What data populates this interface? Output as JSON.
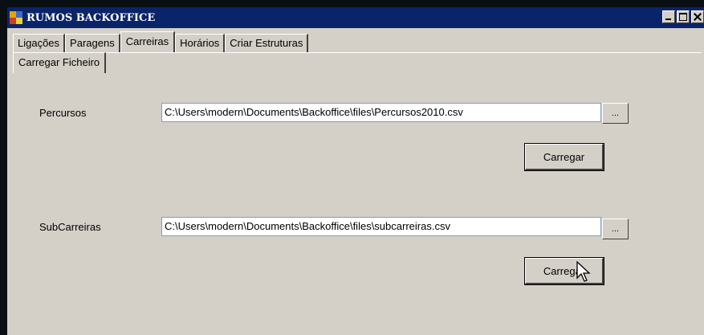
{
  "window": {
    "title": "RUMOS BACKOFFICE"
  },
  "tabs": [
    {
      "label": "Ligações"
    },
    {
      "label": "Paragens"
    },
    {
      "label": "Carreiras"
    },
    {
      "label": "Horários"
    },
    {
      "label": "Criar Estruturas"
    }
  ],
  "active_tab": "Carreiras",
  "subtabs": [
    {
      "label": "Carregar Ficheiro"
    }
  ],
  "percursos": {
    "label": "Percursos",
    "path": "C:\\Users\\modern\\Documents\\Backoffice\\files\\Percursos2010.csv",
    "browse_label": "...",
    "load_label": "Carregar"
  },
  "subcarreiras": {
    "label": "SubCarreiras",
    "path": "C:\\Users\\modern\\Documents\\Backoffice\\files\\subcarreiras.csv",
    "browse_label": "...",
    "load_label": "Carregar"
  },
  "colors": {
    "titlebar": "#0a246a",
    "window_bg": "#d4d0c8"
  }
}
